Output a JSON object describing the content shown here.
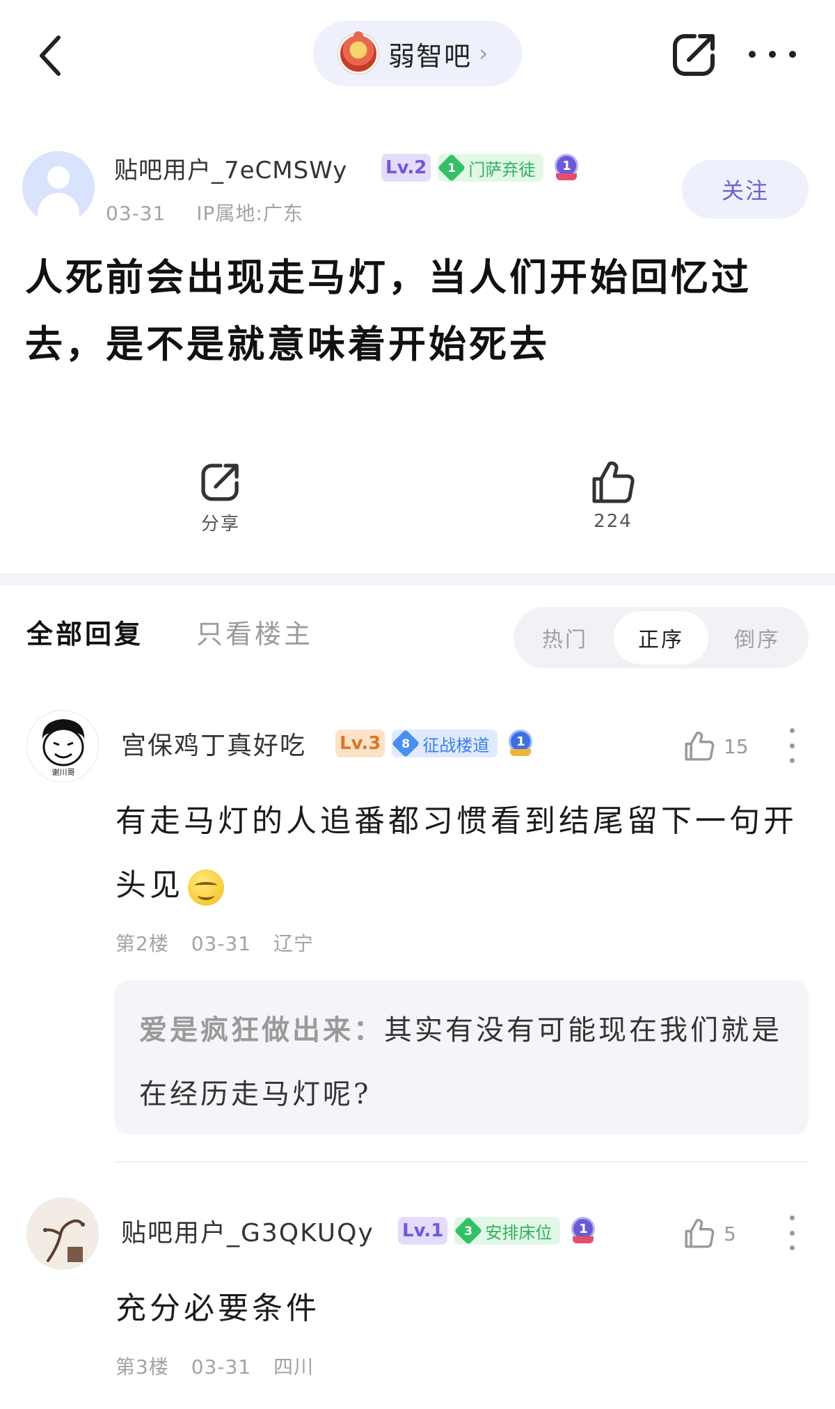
{
  "header": {
    "forum_name": "弱智吧",
    "forum_chevron": "›"
  },
  "post": {
    "author": {
      "name": "贴吧用户_7eCMSWy",
      "level": "Lv.2",
      "title_number": "1",
      "title": "门萨弃徒",
      "medal_number": "1",
      "date": "03-31",
      "ip": "IP属地:广东"
    },
    "follow_label": "关注",
    "title": "人死前会出现走马灯，当人们开始回忆过去，是不是就意味着开始死去",
    "share_label": "分享",
    "like_count": "224"
  },
  "filters": {
    "tab_all": "全部回复",
    "tab_op": "只看楼主",
    "sort_hot": "热门",
    "sort_asc": "正序",
    "sort_desc": "倒序",
    "active_sort": "正序"
  },
  "replies": [
    {
      "name": "宫保鸡丁真好吃",
      "level": "Lv.3",
      "title_number": "8",
      "title": "征战楼道",
      "medal_number": "1",
      "like_count": "15",
      "text": "有走马灯的人追番都习惯看到结尾留下一句开头见",
      "floor": "第2楼",
      "date": "03-31",
      "location": "辽宁",
      "quote": {
        "author": "爱是疯狂做出来：",
        "text": "其实有没有可能现在我们就是在经历走马灯呢?"
      }
    },
    {
      "name": "贴吧用户_G3QKUQy",
      "level": "Lv.1",
      "title_number": "3",
      "title": "安排床位",
      "medal_number": "1",
      "like_count": "5",
      "text": "充分必要条件",
      "floor": "第3楼",
      "date": "03-31",
      "location": "四川"
    }
  ],
  "colors": {
    "accent_purple": "#6b62d8",
    "badge_green": "#34c166",
    "badge_blue": "#4a8ef0",
    "level_orange": "#d8782a"
  }
}
